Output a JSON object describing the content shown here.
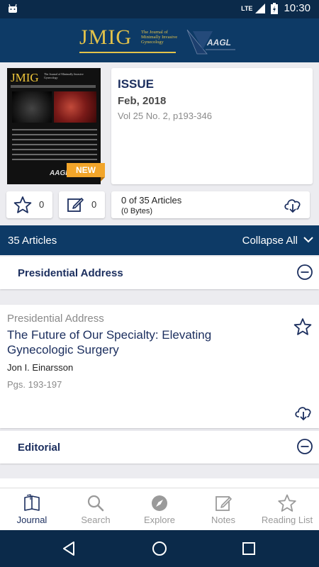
{
  "status_bar": {
    "network": "LTE",
    "time": "10:30"
  },
  "header": {
    "logo": "JMIG",
    "logo_subtitle": "The Journal of Minimally Invasive Gynecology",
    "partner_logo": "AAGL"
  },
  "issue": {
    "cover_title": "JMIG",
    "badge": "NEW",
    "label": "ISSUE",
    "date": "Feb, 2018",
    "volume": "Vol 25 No. 2, p193-346",
    "favorites_count": "0",
    "notes_count": "0",
    "articles_downloaded": "0 of 35 Articles",
    "bytes": "(0 Bytes)"
  },
  "articles_bar": {
    "count_label": "35 Articles",
    "collapse_label": "Collapse All"
  },
  "sections": [
    {
      "title": "Presidential Address"
    },
    {
      "title": "Editorial"
    }
  ],
  "article": {
    "section": "Presidential Address",
    "title": "The Future of Our Specialty: Elevating Gynecologic Surgery",
    "author": "Jon I. Einarsson",
    "pages": "Pgs. 193-197"
  },
  "bottom_nav": [
    {
      "label": "Journal",
      "icon": "journal-icon",
      "active": true
    },
    {
      "label": "Search",
      "icon": "search-icon",
      "active": false
    },
    {
      "label": "Explore",
      "icon": "compass-icon",
      "active": false
    },
    {
      "label": "Notes",
      "icon": "notes-icon",
      "active": false
    },
    {
      "label": "Reading List",
      "icon": "star-icon",
      "active": false
    }
  ],
  "colors": {
    "primary": "#0d3a66",
    "accent_gold": "#e2c24a",
    "badge": "#f2a52a",
    "title_blue": "#1b2e5e"
  }
}
